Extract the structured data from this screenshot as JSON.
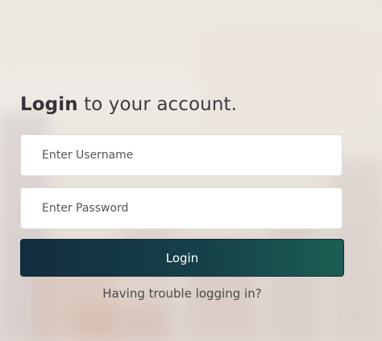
{
  "login": {
    "heading_strong": "Login",
    "heading_rest": " to your account.",
    "username_placeholder": "Enter Username",
    "username_value": "",
    "password_placeholder": "Enter Password",
    "password_value": "",
    "submit_label": "Login",
    "trouble_link": "Having trouble logging in?"
  },
  "colors": {
    "button_start": "#132d3d",
    "button_end": "#1a5e52",
    "heading_text": "#3c3c3e"
  }
}
